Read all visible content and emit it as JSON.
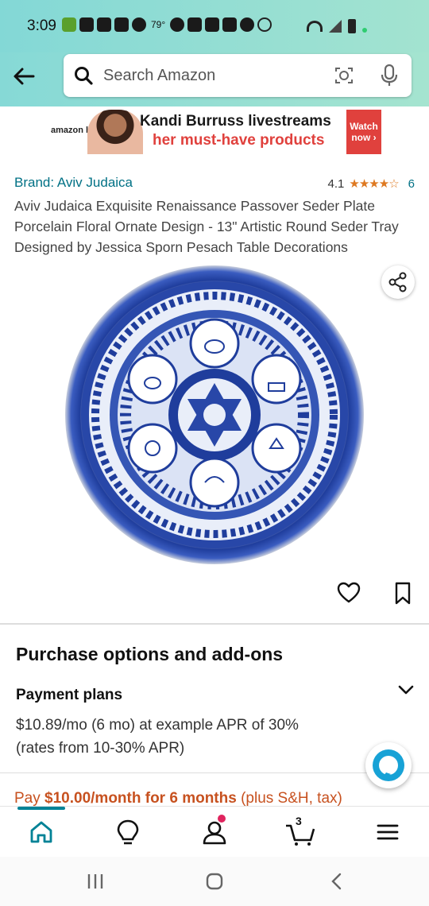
{
  "status_bar": {
    "time": "3:09",
    "temperature": "79°"
  },
  "search": {
    "placeholder": "Search Amazon"
  },
  "ad": {
    "brand": "amazon live",
    "line1": "Kandi Burruss livestreams",
    "line2": "her must-have products",
    "cta": "Watch now ›"
  },
  "product": {
    "brand_link": "Brand: Aviv Judaica",
    "rating": "4.1",
    "stars": "★★★★☆",
    "review_count": "6",
    "title": "Aviv Judaica Exquisite Renaissance Passover Seder Plate Porcelain Floral Ornate Design - 13\" Artistic Round Seder Tray Designed by Jessica Sporn Pesach Table Decorations"
  },
  "purchase": {
    "section_title": "Purchase options and add-ons",
    "payment_plans_label": "Payment plans",
    "payment_detail": "$10.89/mo (6 mo) at example APR of 30% (rates from 10-30% APR)",
    "pay_prefix": "Pay ",
    "pay_bold": "$10.00/month for 6 months",
    "pay_suffix": " (plus S&H, tax)"
  },
  "bottom_nav": {
    "cart_count": "3"
  },
  "colors": {
    "header_gradient": "#86d9d6",
    "link": "#017185",
    "star": "#de7921",
    "offer": "#c7511f",
    "active_tab": "#008296",
    "plate_blue": "#1f3d9c"
  }
}
